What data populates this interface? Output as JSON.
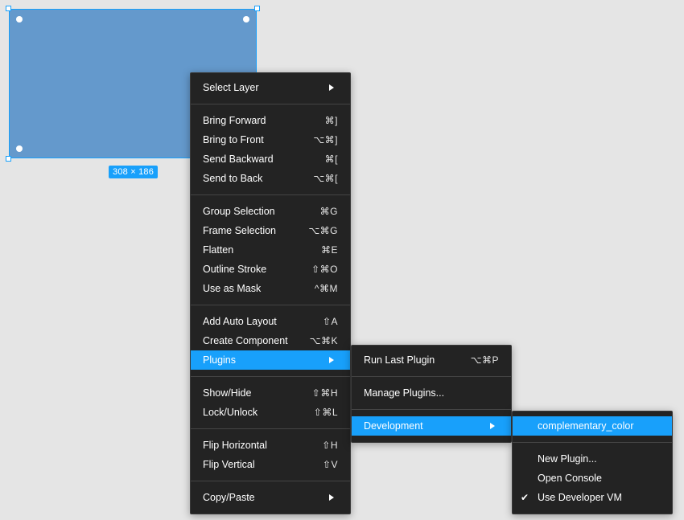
{
  "canvas": {
    "dimensions_label": "308 × 186",
    "frame_color": "#6499cc",
    "selection_color": "#18a0fb"
  },
  "context_menu": {
    "groups": [
      [
        {
          "label": "Select Layer",
          "shortcut": "",
          "submenu": true
        }
      ],
      [
        {
          "label": "Bring Forward",
          "shortcut": "⌘]"
        },
        {
          "label": "Bring to Front",
          "shortcut": "⌥⌘]"
        },
        {
          "label": "Send Backward",
          "shortcut": "⌘["
        },
        {
          "label": "Send to Back",
          "shortcut": "⌥⌘["
        }
      ],
      [
        {
          "label": "Group Selection",
          "shortcut": "⌘G"
        },
        {
          "label": "Frame Selection",
          "shortcut": "⌥⌘G"
        },
        {
          "label": "Flatten",
          "shortcut": "⌘E"
        },
        {
          "label": "Outline Stroke",
          "shortcut": "⇧⌘O"
        },
        {
          "label": "Use as Mask",
          "shortcut": "^⌘M"
        }
      ],
      [
        {
          "label": "Add Auto Layout",
          "shortcut": "⇧A"
        },
        {
          "label": "Create Component",
          "shortcut": "⌥⌘K"
        },
        {
          "label": "Plugins",
          "shortcut": "",
          "submenu": true,
          "active": true
        }
      ],
      [
        {
          "label": "Show/Hide",
          "shortcut": "⇧⌘H"
        },
        {
          "label": "Lock/Unlock",
          "shortcut": "⇧⌘L"
        }
      ],
      [
        {
          "label": "Flip Horizontal",
          "shortcut": "⇧H"
        },
        {
          "label": "Flip Vertical",
          "shortcut": "⇧V"
        }
      ],
      [
        {
          "label": "Copy/Paste",
          "shortcut": "",
          "submenu": true
        }
      ]
    ]
  },
  "plugins_menu": {
    "run_last": {
      "label": "Run Last Plugin",
      "shortcut": "⌥⌘P"
    },
    "manage": {
      "label": "Manage Plugins..."
    },
    "development": {
      "label": "Development"
    }
  },
  "development_menu": {
    "plugin": {
      "label": "complementary_color"
    },
    "new_plugin": {
      "label": "New Plugin..."
    },
    "open_console": {
      "label": "Open Console"
    },
    "use_dev_vm": {
      "label": "Use Developer VM",
      "checked": true
    }
  }
}
